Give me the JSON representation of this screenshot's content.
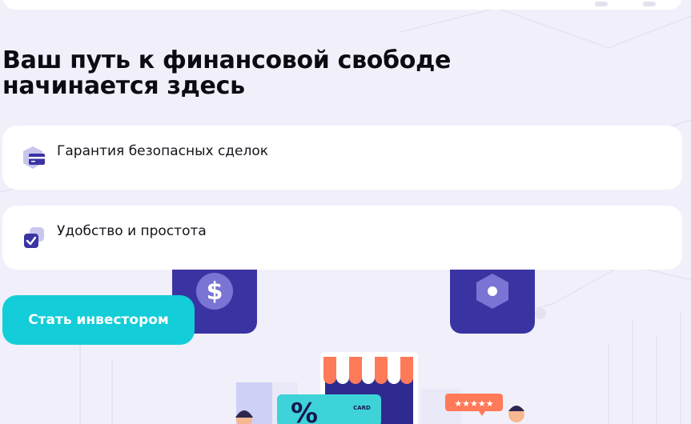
{
  "hero": {
    "headline": "Ваш путь к финансовой свободе начинается здесь"
  },
  "features": [
    {
      "label": "Гарантия безопасных сделок",
      "icon": "credit-card-shield-icon"
    },
    {
      "label": "Удобство и простота",
      "icon": "checkbox-icon"
    }
  ],
  "cta": {
    "label": "Стать инвестором"
  },
  "illustration": {
    "card_text": "CARD",
    "percent_symbol": "%",
    "rating_stars": "★★★★★",
    "icons": [
      "dollar-coin-icon",
      "hexagon-dot-icon"
    ]
  },
  "colors": {
    "background": "#f1f0fa",
    "card": "#ffffff",
    "accent_cyan": "#13cdd8",
    "accent_indigo": "#3a34a3",
    "text": "#0b0b12"
  }
}
